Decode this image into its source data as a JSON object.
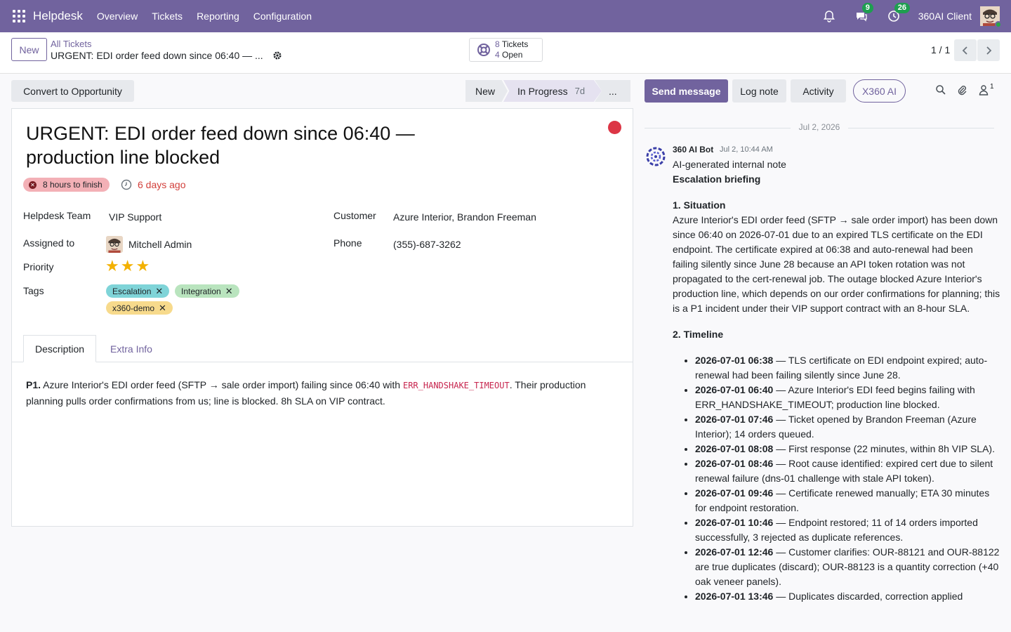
{
  "navbar": {
    "app_name": "Helpdesk",
    "menu": [
      "Overview",
      "Tickets",
      "Reporting",
      "Configuration"
    ],
    "chat_badge": "9",
    "activity_badge": "26",
    "company": "360AI Client",
    "color": "#71639e"
  },
  "control": {
    "new_label": "New",
    "breadcrumb_parent": "All Tickets",
    "breadcrumb_current": "URGENT: EDI order feed down since 06:40 — ...",
    "smart_button": {
      "tickets_count": "8",
      "tickets_label": "Tickets",
      "open_count": "4",
      "open_label": "Open"
    },
    "pager": "1 / 1"
  },
  "form": {
    "convert_label": "Convert to Opportunity",
    "stages": {
      "new": "New",
      "active": "In Progress",
      "active_days": "7d",
      "more": "..."
    },
    "title": "URGENT: EDI order feed down since 06:40 — production line blocked",
    "sla_badge": "8 hours to finish",
    "age": "6 days ago",
    "fields": {
      "team_label": "Helpdesk Team",
      "team_value": "VIP Support",
      "assigned_label": "Assigned to",
      "assigned_value": "Mitchell Admin",
      "priority_label": "Priority",
      "priority_stars": 3,
      "tags_label": "Tags",
      "tags": [
        {
          "name": "Escalation",
          "color": "#7fd4d8"
        },
        {
          "name": "Integration",
          "color": "#b9e4be"
        },
        {
          "name": "x360-demo",
          "color": "#f7da8c"
        }
      ],
      "customer_label": "Customer",
      "customer_value": "Azure Interior, Brandon Freeman",
      "phone_label": "Phone",
      "phone_value": "(355)-687-3262"
    },
    "tabs": {
      "description": "Description",
      "extra": "Extra Info"
    },
    "description": {
      "lead": "P1.",
      "part1": " Azure Interior's EDI order feed (SFTP → sale order import) failing since 06:40 with ",
      "code": "ERR_HANDSHAKE_TIMEOUT",
      "part2": ". Their production planning pulls order confirmations from us; line is blocked. 8h SLA on VIP contract."
    }
  },
  "chatter": {
    "send_label": "Send message",
    "log_label": "Log note",
    "activity_label": "Activity",
    "ai_label": "X360 AI",
    "follower_count": "1",
    "date_separator": "Jul 2, 2026",
    "message": {
      "author": "360 AI Bot",
      "date": "Jul 2, 10:44 AM",
      "subtitle": "AI-generated internal note",
      "heading": "Escalation briefing",
      "section1_title": "1. Situation",
      "section1_text": "Azure Interior's EDI order feed (SFTP → sale order import) has been down since 06:40 on 2026-07-01 due to an expired TLS certificate on the EDI endpoint. The certificate expired at 06:38 and auto-renewal had been failing silently since June 28 because an API token rotation was not propagated to the cert-renewal job. The outage blocked Azure Interior's production line, which depends on our order confirmations for planning; this is a P1 incident under their VIP support contract with an 8-hour SLA.",
      "section2_title": "2. Timeline",
      "timeline": [
        {
          "time": "2026-07-01 06:38",
          "text": " — TLS certificate on EDI endpoint expired; auto-renewal had been failing silently since June 28."
        },
        {
          "time": "2026-07-01 06:40",
          "text": " — Azure Interior's EDI feed begins failing with ERR_HANDSHAKE_TIMEOUT; production line blocked."
        },
        {
          "time": "2026-07-01 07:46",
          "text": " — Ticket opened by Brandon Freeman (Azure Interior); 14 orders queued."
        },
        {
          "time": "2026-07-01 08:08",
          "text": " — First response (22 minutes, within 8h VIP SLA)."
        },
        {
          "time": "2026-07-01 08:46",
          "text": " — Root cause identified: expired cert due to silent renewal failure (dns-01 challenge with stale API token)."
        },
        {
          "time": "2026-07-01 09:46",
          "text": " — Certificate renewed manually; ETA 30 minutes for endpoint restoration."
        },
        {
          "time": "2026-07-01 10:46",
          "text": " — Endpoint restored; 11 of 14 orders imported successfully, 3 rejected as duplicate references."
        },
        {
          "time": "2026-07-01 12:46",
          "text": " — Customer clarifies: OUR-88121 and OUR-88122 are true duplicates (discard); OUR-88123 is a quantity correction (+40 oak veneer panels)."
        },
        {
          "time": "2026-07-01 13:46",
          "text": " — Duplicates discarded, correction applied"
        }
      ]
    }
  }
}
